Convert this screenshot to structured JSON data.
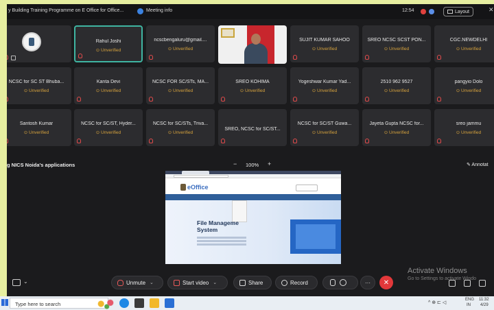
{
  "titlebar": {
    "title": "y Building Training Programme on E Office for Office...",
    "meeting_info": "Meeting info",
    "time": "12:54",
    "layout_label": "Layout"
  },
  "participants": [
    {
      "name": "",
      "status": "",
      "logo": true
    },
    {
      "name": "Rahul Joshi",
      "status": "⊙ Unverified"
    },
    {
      "name": "ncscbengaluru@gmail....",
      "status": "⊙ Unverified"
    },
    {
      "name": "",
      "status": "",
      "video": true
    },
    {
      "name": "SUJIT KUMAR SAHOO",
      "status": "⊙ Unverified"
    },
    {
      "name": "SREO NCSC SCST PON...",
      "status": "⊙ Unverified"
    },
    {
      "name": "CGC.NEWDELHI",
      "status": "⊙ Unverified"
    },
    {
      "name": "NCSC for SC ST Bhuba...",
      "status": "⊙ Unverified"
    },
    {
      "name": "Kanta Devi",
      "status": "⊙ Unverified"
    },
    {
      "name": "NCSC FOR SC/STs, MA...",
      "status": "⊙ Unverified"
    },
    {
      "name": "SREO KOHIMA",
      "status": "⊙ Unverified"
    },
    {
      "name": "Yogeshwar Kumar Yad...",
      "status": "⊙ Unverified"
    },
    {
      "name": "2510 962 9527",
      "status": "⊙ Unverified"
    },
    {
      "name": "pangyio Dolo",
      "status": "⊙ Unverified"
    },
    {
      "name": "Santosh Kumar",
      "status": "⊙ Unverified"
    },
    {
      "name": "NCSC for SC/ST, Hyder...",
      "status": "⊙ Unverified"
    },
    {
      "name": "NCSC for SC/STs, Triva...",
      "status": "⊙ Unverified"
    },
    {
      "name": "SREO, NCSC for SC/ST...",
      "status": ""
    },
    {
      "name": "NCSC for SC/ST Guwa...",
      "status": "⊙ Unverified"
    },
    {
      "name": "Jayeta Gupta NCSC for...",
      "status": "⊙ Unverified"
    },
    {
      "name": "sreo jammu",
      "status": "⊙ Unverified"
    }
  ],
  "share": {
    "label": "g NICS Noida's applications",
    "zoom_minus": "−",
    "zoom": "100%",
    "zoom_plus": "+",
    "annotate": "✎ Annotat",
    "screen_logo": "eOffice",
    "screen_heading_1": "File Manageme",
    "screen_heading_2": "System"
  },
  "controls": {
    "unmute": "Unmute",
    "start_video": "Start video",
    "share": "Share",
    "record": "Record",
    "end_symbol": "✕",
    "more": "···"
  },
  "watermark": {
    "line1": "Activate Windows",
    "line2": "Go to Settings to activate Windo"
  },
  "taskbar": {
    "search_placeholder": "Type here to search",
    "lang": "ENG",
    "region": "IN",
    "clock": "11:32",
    "date": "4/29"
  },
  "colors": {
    "unverified": "#d6a23d",
    "active_border": "#3fb5a2",
    "end_call": "#e2383a",
    "background": "#1b1b1d"
  }
}
